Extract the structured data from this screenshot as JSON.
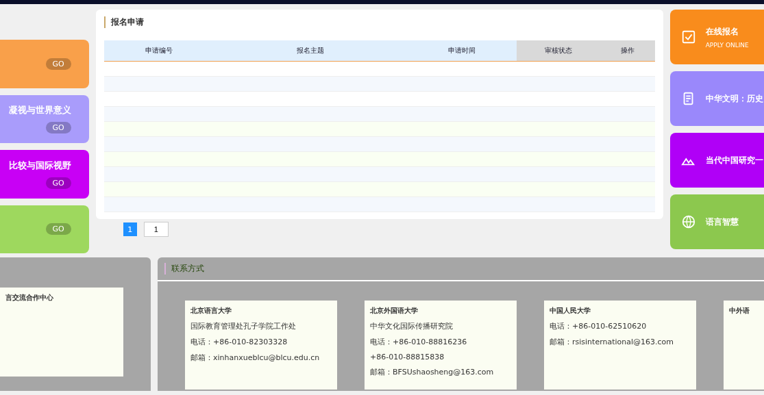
{
  "panel": {
    "title": "报名申请"
  },
  "table": {
    "columns": [
      "申请编号",
      "报名主题",
      "申请时间",
      "审核状态",
      "操作"
    ]
  },
  "left_cards": [
    {
      "go": "GO",
      "color": "#f9a04a"
    },
    {
      "title": "凝视与世界意义",
      "go": "GO",
      "color": "#a99cfb"
    },
    {
      "title": "比较与国际视野",
      "go": "GO",
      "color": "#c800f5"
    },
    {
      "go": "GO",
      "color": "#9ed85e"
    }
  ],
  "right_cards": [
    {
      "title": "在线报名",
      "subtitle": "APPLY ONLINE",
      "color": "#f98c1c"
    },
    {
      "title": "中华文明：历史",
      "color": "#9a88fb"
    },
    {
      "title": "当代中国研究一",
      "color": "#b000f7"
    },
    {
      "title": "语言智慧",
      "color": "#8cc84e"
    }
  ],
  "pagination": {
    "pages": [
      {
        "label": "1",
        "selected": true
      }
    ],
    "jump_value": "1"
  },
  "contact_left": {
    "title": "言交流合作中心"
  },
  "contact": {
    "title": "联系方式",
    "cards": [
      {
        "name": "北京语言大学",
        "lines": [
          "国际教育管理处孔子学院工作处",
          "电话：+86-010-82303328",
          "邮箱：xinhanxueblcu@blcu.edu.cn"
        ]
      },
      {
        "name": "北京外国语大学",
        "lines": [
          "中华文化国际传播研究院",
          "电话：+86-010-88816236",
          "+86-010-88815838",
          "邮箱：BFSUshaosheng@163.com"
        ]
      },
      {
        "name": "中国人民大学",
        "lines": [
          "电话：+86-010-62510620",
          "邮箱：rsisinternational@163.com"
        ]
      },
      {
        "name": "中外语"
      }
    ]
  }
}
